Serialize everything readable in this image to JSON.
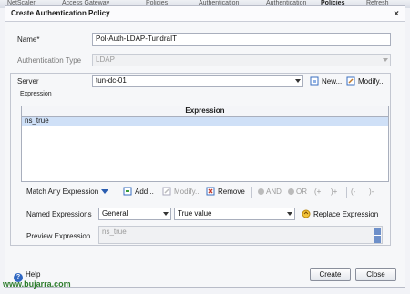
{
  "breadcrumbs": [
    "NetScaler",
    "Access Gateway",
    "Policies",
    "Authentication",
    "Authentication",
    "Policies",
    "Refresh"
  ],
  "dialog": {
    "title": "Create Authentication Policy",
    "close_glyph": "×"
  },
  "form": {
    "name_label": "Name*",
    "name_value": "Pol-Auth-LDAP-TundraIT",
    "auth_type_label": "Authentication Type",
    "auth_type_value": "LDAP",
    "server_label": "Server",
    "server_value": "tun-dc-01",
    "new_label": "New...",
    "modify_label": "Modify..."
  },
  "expression": {
    "group_label": "Expression",
    "column_header": "Expression",
    "rows": [
      "ns_true"
    ],
    "match_label": "Match Any Expression",
    "add_label": "Add...",
    "modify_label": "Modify...",
    "remove_label": "Remove",
    "and_label": "AND",
    "or_label": "OR",
    "op_open_plus": "(+",
    "op_close_plus": ")+",
    "op_open_minus": "(-",
    "op_close_minus": ")-",
    "named_label": "Named Expressions",
    "named_select": "General",
    "named_value": "True value",
    "replace_label": "Replace Expression",
    "preview_label": "Preview Expression",
    "preview_value": "ns_true"
  },
  "footer": {
    "help_label": "Help",
    "create_label": "Create",
    "close_label": "Close"
  },
  "watermark": "www.bujarra.com",
  "colors": {
    "selected_row": "#cfe0f7",
    "accent": "#2a5db0",
    "watermark": "#2e7d2e"
  }
}
